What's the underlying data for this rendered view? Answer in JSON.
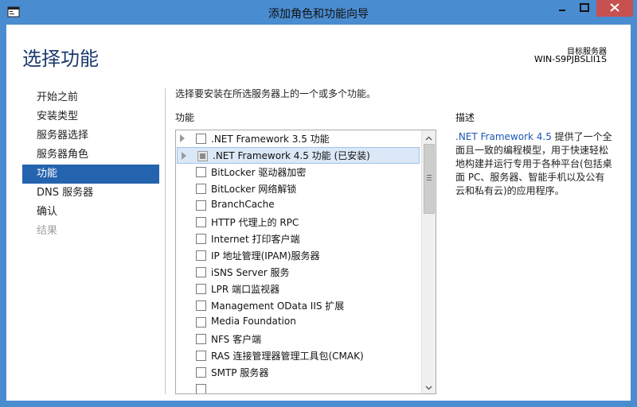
{
  "window": {
    "title": "添加角色和功能向导",
    "icons": {
      "app": "server-manager-icon",
      "minimize": "minimize-icon",
      "maximize": "maximize-icon",
      "close": "close-icon"
    }
  },
  "header": {
    "page_title": "选择功能",
    "target_label": "目标服务器",
    "target_server": "WIN-S9PJBSLII1S"
  },
  "nav": {
    "items": [
      {
        "label": "开始之前",
        "state": "normal"
      },
      {
        "label": "安装类型",
        "state": "normal"
      },
      {
        "label": "服务器选择",
        "state": "normal"
      },
      {
        "label": "服务器角色",
        "state": "normal"
      },
      {
        "label": "功能",
        "state": "active"
      },
      {
        "label": "DNS 服务器",
        "state": "normal"
      },
      {
        "label": "确认",
        "state": "normal"
      },
      {
        "label": "结果",
        "state": "disabled"
      }
    ]
  },
  "main": {
    "instruction": "选择要安装在所选服务器上的一个或多个功能。",
    "features_label": "功能",
    "features": [
      {
        "label": ".NET Framework 3.5 功能",
        "expandable": true,
        "checked": false
      },
      {
        "label": ".NET Framework 4.5 功能 (已安装)",
        "expandable": true,
        "checked": "installed",
        "selected": true
      },
      {
        "label": "BitLocker 驱动器加密",
        "expandable": false,
        "checked": false
      },
      {
        "label": "BitLocker 网络解锁",
        "expandable": false,
        "checked": false
      },
      {
        "label": "BranchCache",
        "expandable": false,
        "checked": false
      },
      {
        "label": "HTTP 代理上的 RPC",
        "expandable": false,
        "checked": false
      },
      {
        "label": "Internet 打印客户端",
        "expandable": false,
        "checked": false
      },
      {
        "label": "IP 地址管理(IPAM)服务器",
        "expandable": false,
        "checked": false
      },
      {
        "label": "iSNS Server 服务",
        "expandable": false,
        "checked": false
      },
      {
        "label": "LPR 端口监视器",
        "expandable": false,
        "checked": false
      },
      {
        "label": "Management OData IIS 扩展",
        "expandable": false,
        "checked": false
      },
      {
        "label": "Media Foundation",
        "expandable": false,
        "checked": false
      },
      {
        "label": "NFS 客户端",
        "expandable": false,
        "checked": false
      },
      {
        "label": "RAS 连接管理器管理工具包(CMAK)",
        "expandable": false,
        "checked": false
      },
      {
        "label": "SMTP 服务器",
        "expandable": false,
        "checked": false
      },
      {
        "label": "",
        "expandable": false,
        "checked": false
      }
    ]
  },
  "description": {
    "title": "描述",
    "link_text": ".NET Framework 4.5",
    "body": " 提供了一个全面且一致的编程模型，用于快速轻松地构建并运行专用于各种平台(包括桌面 PC、服务器、智能手机以及公有云和私有云)的应用程序。"
  },
  "colors": {
    "title_bar": "#4a8cd0",
    "nav_active": "#2463ae",
    "page_title": "#1b3a6d",
    "link": "#1a58b3",
    "close_button": "#c75050"
  }
}
